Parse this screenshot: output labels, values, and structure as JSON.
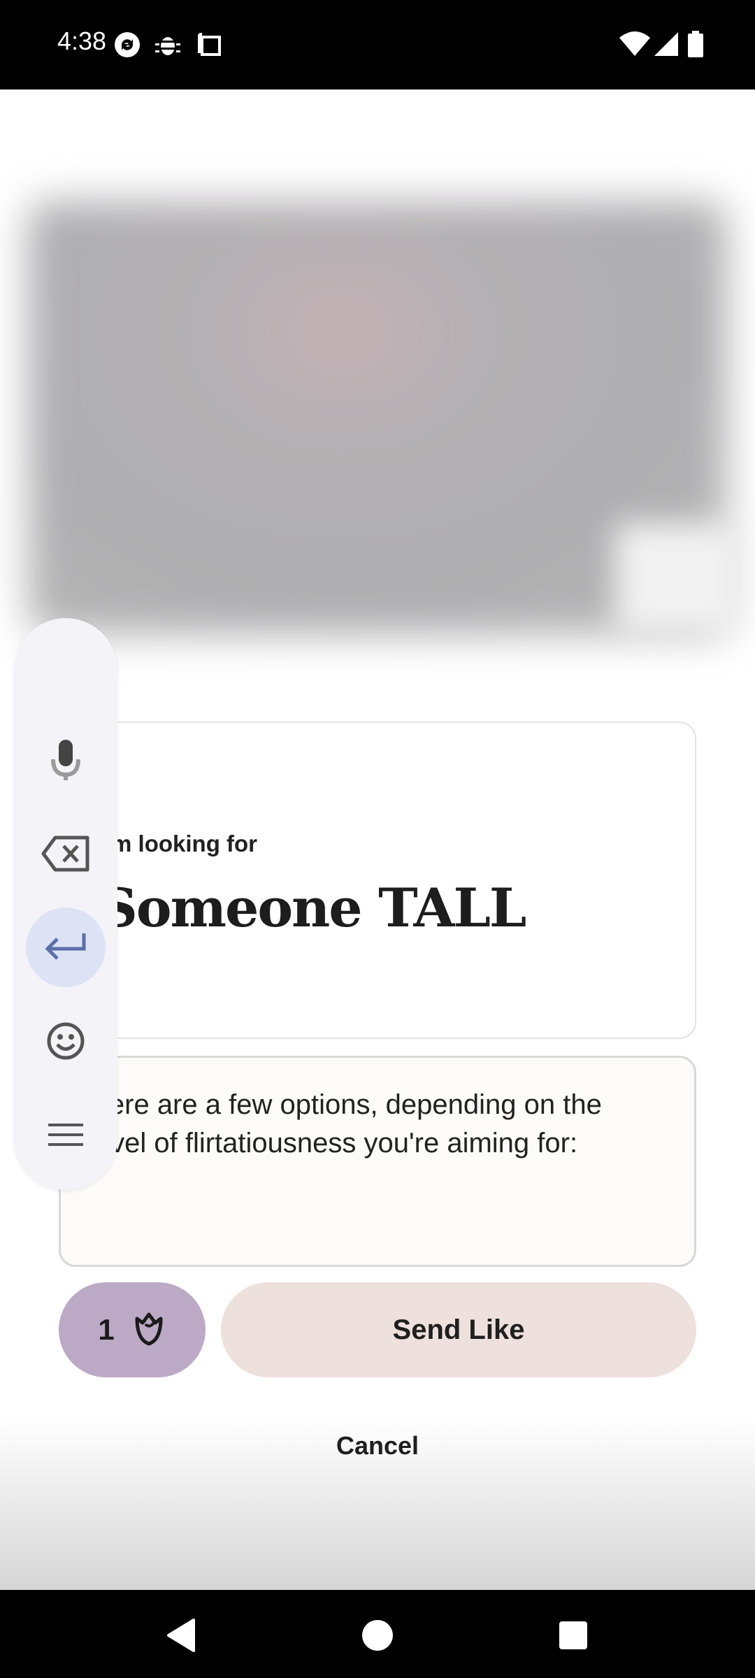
{
  "status_bar": {
    "time": "4:38",
    "icons": [
      "sync-icon",
      "bug-icon",
      "screenshot-icon",
      "wifi-icon",
      "signal-icon",
      "battery-icon"
    ]
  },
  "prompt": {
    "label": "I'm looking for",
    "answer": "Someone TALL"
  },
  "comment": {
    "text": "Here are a few options, depending on the level of flirtatiousness you're aiming for:"
  },
  "rose_button": {
    "count": "1",
    "icon": "rose-icon",
    "color": "#bca9c5"
  },
  "send_like": {
    "label": "Send Like",
    "color": "#eee0dd"
  },
  "cancel": {
    "label": "Cancel"
  },
  "keyboard_toolbar": {
    "items": [
      "microphone-icon",
      "backspace-icon",
      "enter-icon",
      "emoji-icon",
      "menu-icon"
    ],
    "active": "enter-icon"
  },
  "nav_bar": {
    "items": [
      "back-icon",
      "home-icon",
      "recents-icon"
    ]
  }
}
